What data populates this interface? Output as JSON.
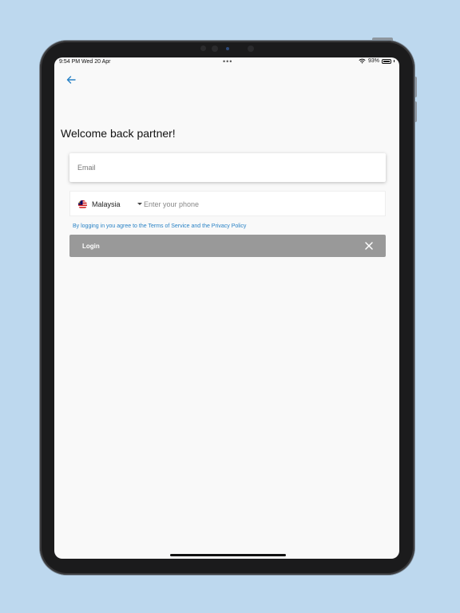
{
  "status_bar": {
    "time": "9:54 PM  Wed 20 Apr",
    "battery": "93%"
  },
  "page": {
    "title": "Welcome back partner!"
  },
  "form": {
    "email_placeholder": "Email",
    "country": "Malaysia",
    "phone_placeholder": "Enter your phone",
    "terms_text": "By logging in you agree to the Terms of Service and the Privacy Policy",
    "login_label": "Login"
  },
  "icons": {
    "back": "arrow-left-icon",
    "close": "close-icon",
    "flag": "malaysia-flag-icon",
    "caret": "chevron-down-icon",
    "wifi": "wifi-icon",
    "battery": "battery-icon"
  },
  "colors": {
    "accent": "#2a83c6",
    "login_bg": "#999999",
    "background": "#bdd8ee"
  }
}
